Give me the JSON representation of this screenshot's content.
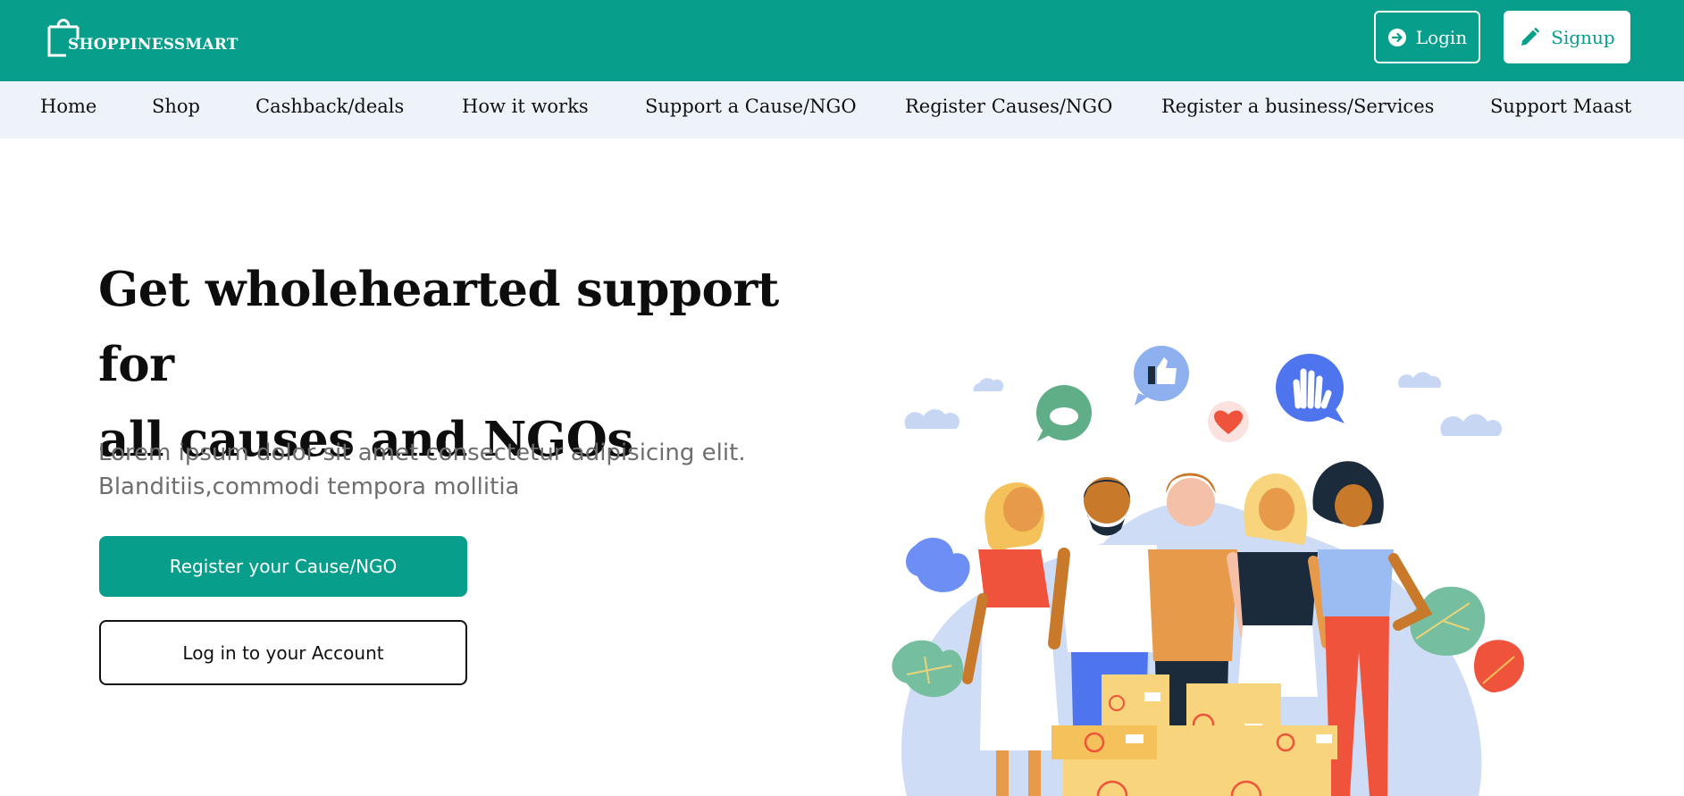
{
  "header": {
    "logo_text": "SHOPPINESSMART",
    "login_label": "Login",
    "signup_label": "Signup"
  },
  "nav": {
    "items": [
      {
        "label": "Home"
      },
      {
        "label": "Shop"
      },
      {
        "label": "Cashback/deals"
      },
      {
        "label": "How it works"
      },
      {
        "label": "Support a Cause/NGO"
      },
      {
        "label": "Register Causes/NGO"
      },
      {
        "label": "Register a business/Services"
      },
      {
        "label": "Support Maast"
      }
    ]
  },
  "hero": {
    "title_line1": "Get wholehearted support for",
    "title_line2": "all causes and NGOs",
    "subtitle_line1": "Lorem ipsum dolor sit amet consectetur adipisicing elit.",
    "subtitle_line2": "Blanditiis,commodi tempora mollitia",
    "primary_button": "Register your Cause/NGO",
    "secondary_button": "Log in to your Account"
  },
  "colors": {
    "brand": "#079e8c",
    "nav_bg": "#edf3f9"
  },
  "icons": {
    "logo": "shopping-bag-icon",
    "login": "arrow-circle-right-icon",
    "signup": "pencil-icon"
  }
}
